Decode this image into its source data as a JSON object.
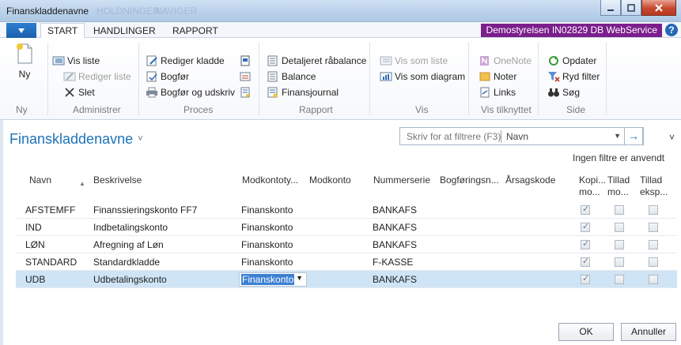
{
  "window": {
    "title": "Finanskladdenavne",
    "ghost_text_1": "HOLDNINGER",
    "ghost_text_2": "NAVIGER"
  },
  "tabs": {
    "start": "START",
    "handlinger": "HANDLINGER",
    "rapport": "RAPPORT"
  },
  "company_badge": "Demostyrelsen IN02829 DB WebService",
  "help_glyph": "?",
  "ribbon": {
    "ny": {
      "label": "Ny",
      "group": "Ny"
    },
    "administrer": {
      "group": "Administrer",
      "vis_liste": "Vis liste",
      "rediger_liste": "Rediger liste",
      "slet": "Slet"
    },
    "proces": {
      "group": "Proces",
      "rediger_kladde": "Rediger kladde",
      "bogfor": "Bogfør",
      "bogfor_udskriv": "Bogfør og udskriv"
    },
    "rapport": {
      "group": "Rapport",
      "detaljeret": "Detaljeret råbalance",
      "balance": "Balance",
      "finansjournal": "Finansjournal"
    },
    "vis": {
      "group": "Vis",
      "vis_som_liste": "Vis som liste",
      "vis_som_diagram": "Vis som diagram"
    },
    "vis_tilknyttet": {
      "group": "Vis tilknyttet",
      "onenote": "OneNote",
      "noter": "Noter",
      "links": "Links"
    },
    "side": {
      "group": "Side",
      "opdater": "Opdater",
      "ryd_filter": "Ryd filter",
      "sog": "Søg"
    }
  },
  "page": {
    "title": "Finanskladdenavne",
    "title_caret": "˅",
    "filter_placeholder": "Skriv for at filtrere (F3)",
    "filter_field": "Navn",
    "filter_go": "→",
    "collapse_glyph": "˅",
    "no_filters": "Ingen filtre er anvendt"
  },
  "table": {
    "headers": {
      "navn": "Navn",
      "beskrivelse": "Beskrivelse",
      "modkontotype": "Modkontoty...",
      "modkonto": "Modkonto",
      "nummerserie": "Nummerserie",
      "bogforingsn": "Bogføringsn...",
      "arsagskode": "Årsagskode",
      "kopi_1": "Kopi...",
      "kopi_2": "mo...",
      "tillad1_1": "Tillad",
      "tillad1_2": "mo...",
      "tillad2_1": "Tillad",
      "tillad2_2": "eksp..."
    },
    "rows": [
      {
        "navn": "AFSTEMFF",
        "beskrivelse": "Finanssieringskonto FF7",
        "modkontotype": "Finanskonto",
        "nummerserie": "BANKAFS",
        "kopi": true,
        "tillad_mo": false,
        "tillad_eksp": false
      },
      {
        "navn": "IND",
        "beskrivelse": "Indbetalingskonto",
        "modkontotype": "Finanskonto",
        "nummerserie": "BANKAFS",
        "kopi": true,
        "tillad_mo": false,
        "tillad_eksp": false
      },
      {
        "navn": "LØN",
        "beskrivelse": "Afregning af Løn",
        "modkontotype": "Finanskonto",
        "nummerserie": "BANKAFS",
        "kopi": true,
        "tillad_mo": false,
        "tillad_eksp": false
      },
      {
        "navn": "STANDARD",
        "beskrivelse": "Standardkladde",
        "modkontotype": "Finanskonto",
        "nummerserie": "F-KASSE",
        "kopi": true,
        "tillad_mo": false,
        "tillad_eksp": false
      },
      {
        "navn": "UDB",
        "beskrivelse": "Udbetalingskonto",
        "modkontotype": "Finanskonto",
        "nummerserie": "BANKAFS",
        "kopi": true,
        "tillad_mo": false,
        "tillad_eksp": false
      }
    ]
  },
  "buttons": {
    "ok": "OK",
    "annuller": "Annuller"
  },
  "colors": {
    "accent_blue": "#1d73b9",
    "company_purple": "#7a1f8c",
    "selected_row": "#cfe4f5"
  }
}
